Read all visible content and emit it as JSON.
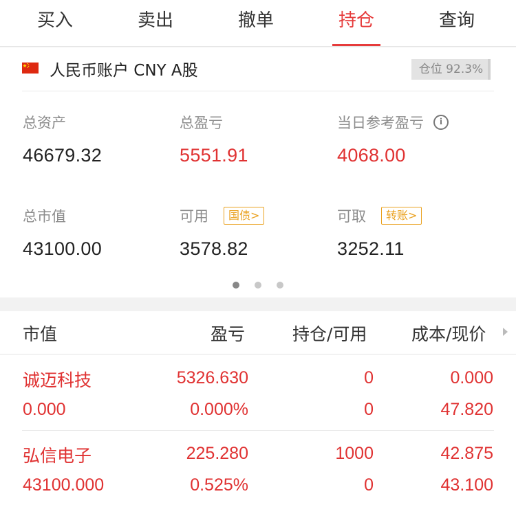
{
  "tabs": [
    {
      "label": "买入",
      "active": false
    },
    {
      "label": "卖出",
      "active": false
    },
    {
      "label": "撤单",
      "active": false
    },
    {
      "label": "持仓",
      "active": true
    },
    {
      "label": "查询",
      "active": false
    }
  ],
  "account": {
    "title": "人民币账户 CNY A股",
    "position_label": "仓位 92.3%",
    "total_assets": {
      "label": "总资产",
      "value": "46679.32"
    },
    "total_pnl": {
      "label": "总盈亏",
      "value": "5551.91"
    },
    "daily_pnl": {
      "label": "当日参考盈亏",
      "value": "4068.00"
    },
    "market_value": {
      "label": "总市值",
      "value": "43100.00"
    },
    "available": {
      "label": "可用",
      "value": "3578.82",
      "tag": "国债>"
    },
    "withdrawable": {
      "label": "可取",
      "value": "3252.11",
      "tag": "转账>"
    },
    "page_count": 3,
    "active_page": 0
  },
  "holdings": {
    "headers": {
      "market_value": "市值",
      "pnl": "盈亏",
      "position": "持仓/可用",
      "cost_price": "成本/现价"
    },
    "rows": [
      {
        "name": "诚迈科技",
        "market_value": "0.000",
        "pnl": "5326.630",
        "pnl_pct": "0.000%",
        "position": "0",
        "available": "0",
        "cost": "0.000",
        "price": "47.820"
      },
      {
        "name": "弘信电子",
        "market_value": "43100.000",
        "pnl": "225.280",
        "pnl_pct": "0.525%",
        "position": "1000",
        "available": "0",
        "cost": "42.875",
        "price": "43.100"
      }
    ]
  },
  "colors": {
    "accent_red": "#e03232",
    "tag_orange": "#eaa11f"
  }
}
